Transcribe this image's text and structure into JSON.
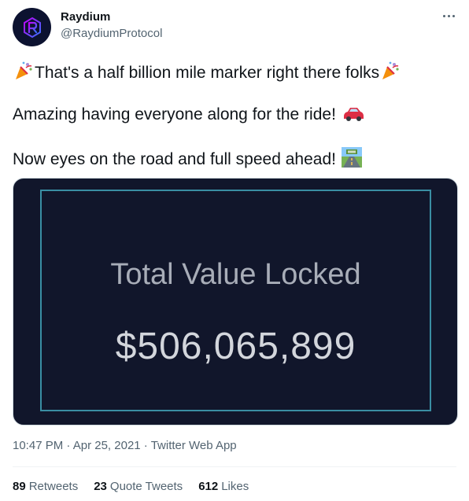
{
  "author": {
    "display_name": "Raydium",
    "handle": "@RaydiumProtocol"
  },
  "tweet": {
    "line1": "That's a half billion mile marker right there folks",
    "line2": "Amazing having everyone along for the ride!",
    "line3": "Now eyes on the road and full speed ahead!"
  },
  "media": {
    "title": "Total Value Locked",
    "value": "$506,065,899"
  },
  "meta": {
    "time": "10:47 PM",
    "date": "Apr 25, 2021",
    "source": "Twitter Web App"
  },
  "stats": {
    "retweets_count": "89",
    "retweets_label": "Retweets",
    "quotes_count": "23",
    "quotes_label": "Quote Tweets",
    "likes_count": "612",
    "likes_label": "Likes"
  },
  "colors": {
    "media_background": "#11162b",
    "media_frame": "#3a8ea3",
    "secondary_text": "#536471"
  },
  "icons": [
    "raydium-logo-icon",
    "party-popper-icon",
    "car-icon",
    "road-icon",
    "more-icon"
  ]
}
